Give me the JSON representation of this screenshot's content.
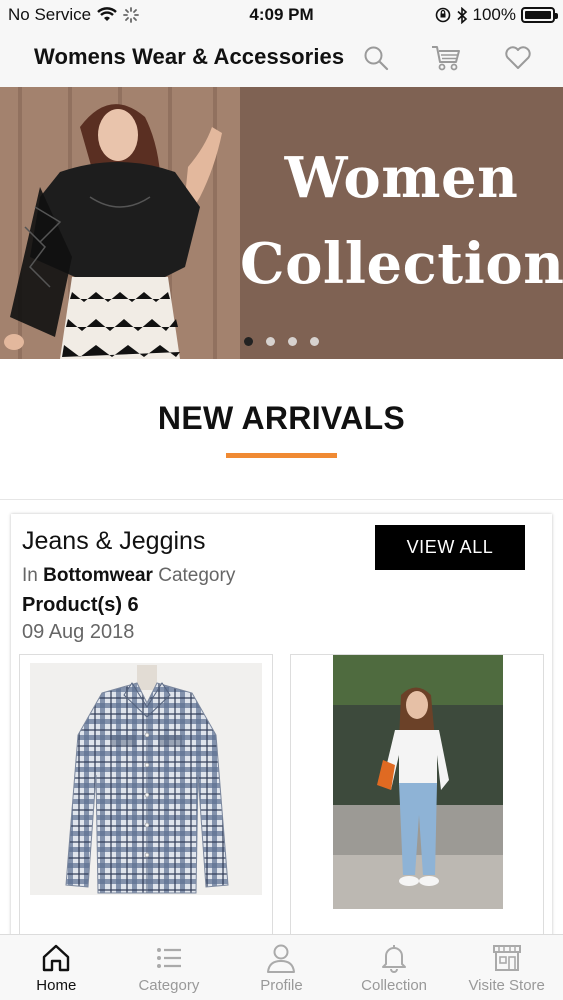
{
  "status_bar": {
    "carrier": "No Service",
    "time": "4:09 PM",
    "battery": "100%"
  },
  "header": {
    "title": "Womens Wear & Accessories",
    "icons": [
      "search-icon",
      "cart-icon",
      "heart-icon"
    ]
  },
  "banner": {
    "line1": "Women",
    "line2": "Collection",
    "dots": 4,
    "active_dot": 1
  },
  "new_arrivals": {
    "title": "NEW ARRIVALS",
    "accent_color": "#f08a33"
  },
  "card": {
    "title": "Jeans & Jeggins",
    "category_prefix": "In",
    "category": "Bottomwear",
    "category_suffix": "Category",
    "product_count": "Product(s) 6",
    "date": "09 Aug 2018",
    "view_all_label": "VIEW ALL"
  },
  "tabs": [
    {
      "label": "Home",
      "icon": "home-icon",
      "active": true
    },
    {
      "label": "Category",
      "icon": "list-icon",
      "active": false
    },
    {
      "label": "Profile",
      "icon": "person-icon",
      "active": false
    },
    {
      "label": "Collection",
      "icon": "bell-icon",
      "active": false
    },
    {
      "label": "Visite Store",
      "icon": "store-icon",
      "active": false
    }
  ]
}
